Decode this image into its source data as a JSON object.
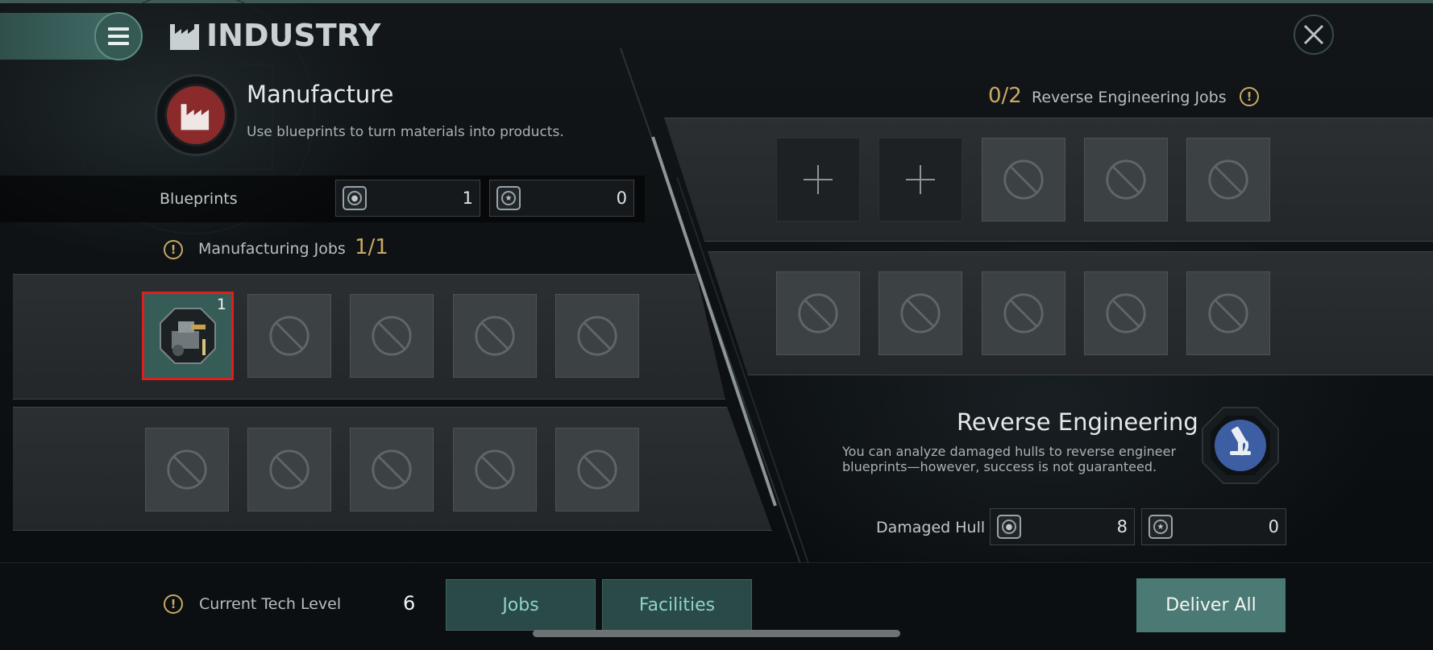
{
  "header": {
    "title": "INDUSTRY",
    "menu_icon": "hamburger-menu-icon",
    "title_icon": "factory-icon",
    "close_icon": "close-icon"
  },
  "manufacture": {
    "title": "Manufacture",
    "description": "Use blueprints to turn materials into products.",
    "icon": "factory-icon",
    "icon_color": "#8a2a2a",
    "blueprints_label": "Blueprints",
    "blueprint_counts": [
      "1",
      "0"
    ],
    "jobs_label": "Manufacturing Jobs",
    "jobs_count": "1/1",
    "active_job_quantity": "1"
  },
  "reverse_engineering": {
    "jobs_count": "0/2",
    "jobs_label": "Reverse Engineering Jobs",
    "title": "Reverse Engineering",
    "description": "You can analyze damaged hulls to reverse engineer blueprints—however, success is not guaranteed.",
    "icon": "microscope-icon",
    "icon_color": "#3e5ea3",
    "damaged_hull_label": "Damaged Hull",
    "damaged_hull_counts": [
      "8",
      "0"
    ]
  },
  "footer": {
    "tech_level_label": "Current Tech Level",
    "tech_level_value": "6",
    "tabs": [
      "Jobs",
      "Facilities"
    ],
    "deliver_all_label": "Deliver All"
  },
  "colors": {
    "accent": "#4a7a73",
    "gold": "#c9a964",
    "highlight": "#e01e1e"
  }
}
